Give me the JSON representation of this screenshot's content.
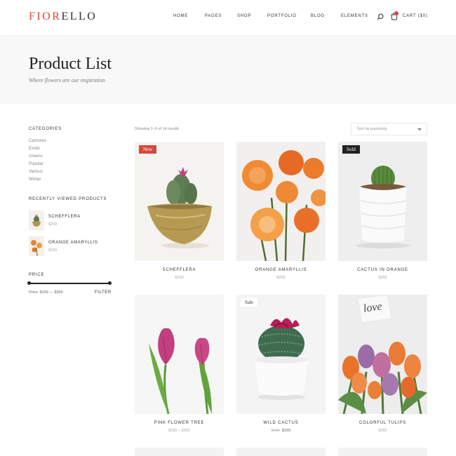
{
  "header": {
    "logo_accent": "FIOR",
    "logo_rest": "ELLO",
    "nav": [
      "HOME",
      "PAGES",
      "SHOP",
      "PORTFOLIO",
      "BLOG",
      "ELEMENTS"
    ],
    "cart_label": "CART ($0)",
    "icons": {
      "search": "search-icon",
      "cart": "cart-icon"
    },
    "accent_color": "#d9473c"
  },
  "title_band": {
    "title": "Product List",
    "subtitle": "Where flowers are our inspiration"
  },
  "sidebar": {
    "categories_heading": "CATEGORIES",
    "categories": [
      "Cactuses",
      "Exotic",
      "Greens",
      "Popular",
      "Various",
      "Winter"
    ],
    "recent_heading": "RECENTLY VIEWED PRODUCTS",
    "recent": [
      {
        "name": "SCHEFFLERA",
        "price": "$259"
      },
      {
        "name": "ORANGE AMARYLLIS",
        "price": "$259"
      }
    ],
    "price_heading": "PRICE",
    "price_range": "Price: $159 — $350",
    "filter_label": "FILTER"
  },
  "toolbar": {
    "results": "Showing 1–9 of 14 results",
    "sort": "Sort by popularity"
  },
  "products": [
    {
      "name": "SCHEFFLERA",
      "price": "$259",
      "badge": "New"
    },
    {
      "name": "ORANGE AMARYLLIS",
      "price": "$259",
      "badge": ""
    },
    {
      "name": "CACTUS IN ORANGE",
      "price": "$259",
      "badge": "Sold"
    },
    {
      "name": "PINK FLOWER TREE",
      "price": "$180 – $350",
      "badge": ""
    },
    {
      "name": "WILD CACTUS",
      "price_old": "$259",
      "price_new": "$159",
      "badge": "Sale"
    },
    {
      "name": "COLORFUL TULIPS",
      "price": "$350",
      "badge": "",
      "card_text": "love"
    }
  ]
}
